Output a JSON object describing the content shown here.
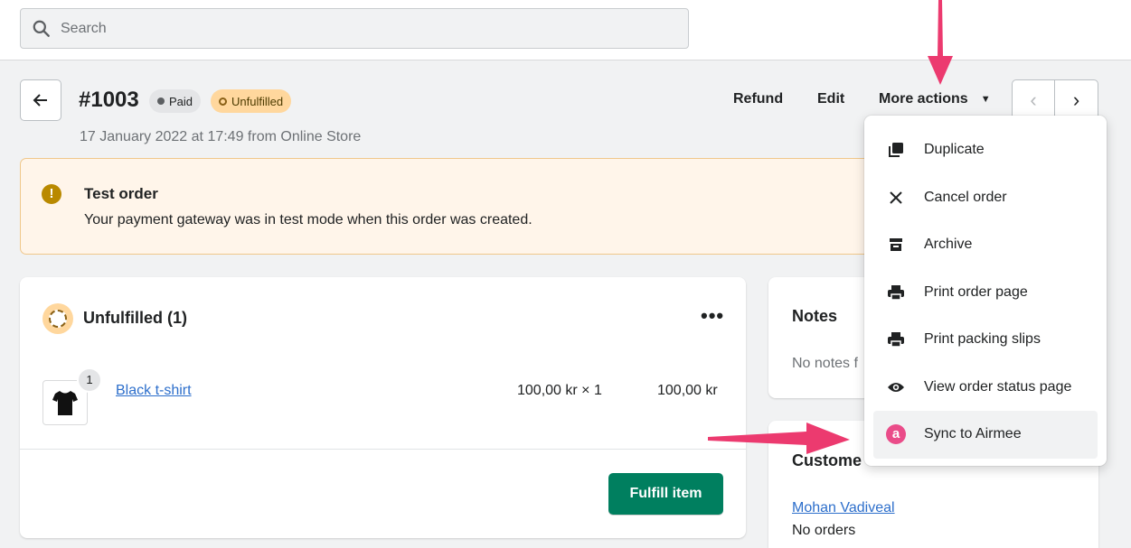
{
  "search": {
    "placeholder": "Search"
  },
  "order": {
    "number": "#1003",
    "paid_badge": "Paid",
    "fulfillment_badge": "Unfulfilled",
    "subtitle": "17 January 2022 at 17:49 from Online Store"
  },
  "header_actions": {
    "refund": "Refund",
    "edit": "Edit",
    "more_actions": "More actions"
  },
  "banner": {
    "title": "Test order",
    "text": "Your payment gateway was in test mode when this order was created."
  },
  "fulfillment_card": {
    "title": "Unfulfilled (1)",
    "item": {
      "quantity_badge": "1",
      "name": "Black t-shirt",
      "price": "100,00 kr × 1",
      "total": "100,00 kr"
    },
    "fulfill_button": "Fulfill item"
  },
  "notes_card": {
    "title": "Notes",
    "text": "No notes f"
  },
  "customer_card": {
    "title": "Custome",
    "name": "Mohan Vadiveal",
    "orders": "No orders"
  },
  "more_actions_menu": [
    {
      "label": "Duplicate",
      "icon": "duplicate-icon"
    },
    {
      "label": "Cancel order",
      "icon": "close-icon"
    },
    {
      "label": "Archive",
      "icon": "archive-icon"
    },
    {
      "label": "Print order page",
      "icon": "printer-icon"
    },
    {
      "label": "Print packing slips",
      "icon": "printer-icon"
    },
    {
      "label": "View order status page",
      "icon": "eye-icon"
    },
    {
      "label": "Sync to Airmee",
      "icon": "airmee-logo-icon",
      "logo_letter": "a",
      "highlighted": true
    }
  ],
  "colors": {
    "primary_button": "#007f5f",
    "link": "#2c6ecb",
    "warning_banner_bg": "#fff5ea",
    "unfulfilled_badge_bg": "#ffd79d",
    "annotation_arrow": "#ec3a6f",
    "airmee_brand": "#ea4c89"
  }
}
